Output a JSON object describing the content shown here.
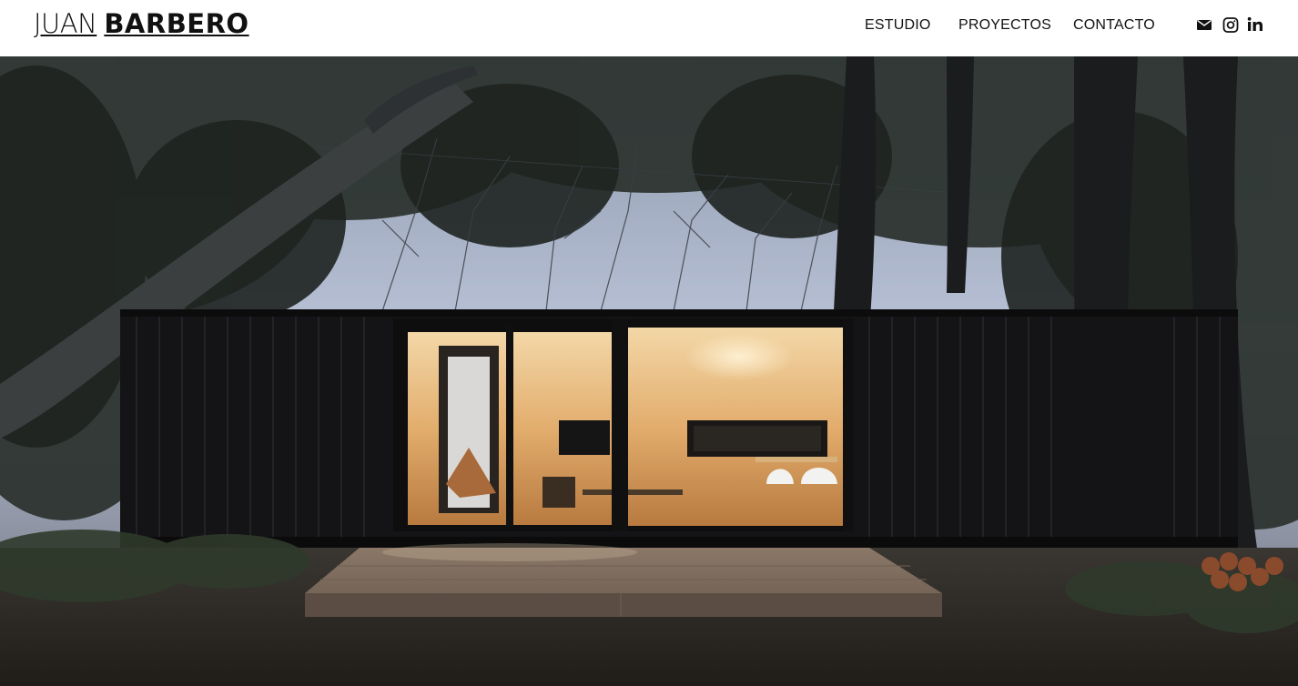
{
  "brand": {
    "name_light": "JUAN",
    "name_bold": "BARBERO"
  },
  "nav": {
    "items": [
      {
        "label": "ESTUDIO"
      },
      {
        "label": "PROYECTOS"
      },
      {
        "label": "CONTACTO"
      }
    ]
  },
  "social": {
    "icons": [
      "mail-icon",
      "instagram-icon",
      "linkedin-icon"
    ]
  },
  "hero": {
    "image": "hero-photo",
    "colors": {
      "sky": "#b9c2d6",
      "container": "#141416",
      "interior": "#e8b877",
      "ground": "#2b2622"
    }
  }
}
